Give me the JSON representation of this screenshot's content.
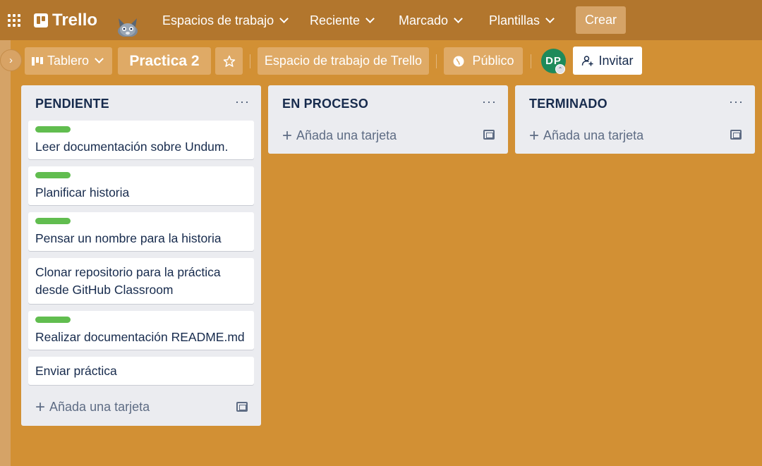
{
  "app": {
    "name": "Trello"
  },
  "nav": {
    "items": [
      {
        "label": "Espacios de trabajo"
      },
      {
        "label": "Reciente"
      },
      {
        "label": "Marcado"
      },
      {
        "label": "Plantillas"
      }
    ],
    "create_label": "Crear"
  },
  "board": {
    "view_label": "Tablero",
    "title": "Practica 2",
    "workspace_label": "Espacio de trabajo de Trello",
    "visibility_label": "Público",
    "avatar_initials": "DP",
    "invite_label": "Invitar"
  },
  "lists": [
    {
      "title": "PENDIENTE",
      "cards": [
        {
          "text": "Leer documentación sobre Undum.",
          "label_color": "#61bd4f"
        },
        {
          "text": "Planificar historia",
          "label_color": "#61bd4f"
        },
        {
          "text": "Pensar un nombre para la historia",
          "label_color": "#61bd4f"
        },
        {
          "text_line1": "Clonar repositorio para la práctica",
          "text_line2": "desde GitHub Classroom"
        },
        {
          "text": "Realizar documentación README.md",
          "label_color": "#61bd4f"
        },
        {
          "text": "Enviar práctica"
        }
      ],
      "add_label": "Añada una tarjeta"
    },
    {
      "title": "EN PROCESO",
      "cards": [],
      "add_label": "Añada una tarjeta"
    },
    {
      "title": "TERMINADO",
      "cards": [],
      "add_label": "Añada una tarjeta"
    }
  ],
  "colors": {
    "board_background": "#d29034",
    "topbar": "#b2762d",
    "label_green": "#61bd4f",
    "avatar": "#1e8a5a"
  }
}
